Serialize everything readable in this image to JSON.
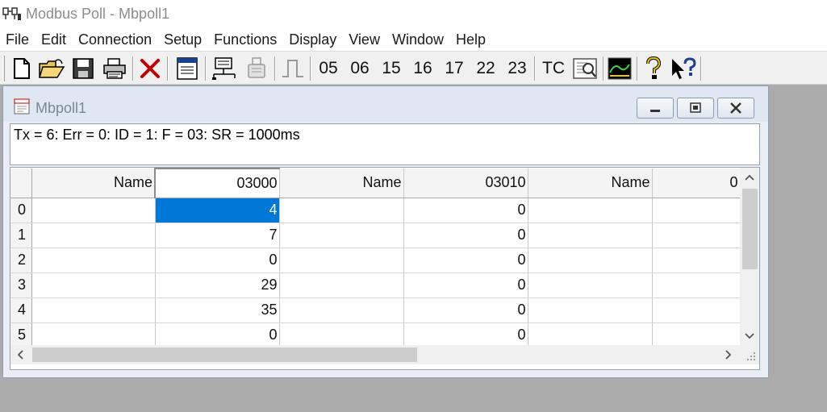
{
  "app": {
    "title": "Modbus Poll - Mbpoll1"
  },
  "menu": [
    "File",
    "Edit",
    "Connection",
    "Setup",
    "Functions",
    "Display",
    "View",
    "Window",
    "Help"
  ],
  "toolbar": {
    "function_codes": [
      "05",
      "06",
      "15",
      "16",
      "17",
      "22",
      "23"
    ],
    "tc_label": "TC"
  },
  "child": {
    "title": "Mbpoll1",
    "status": "Tx = 6: Err = 0: ID = 1: F = 03: SR = 1000ms"
  },
  "grid": {
    "headers": [
      "Name",
      "03000",
      "Name",
      "03010",
      "Name",
      "0"
    ],
    "rows": [
      {
        "index": "0",
        "c1": "",
        "c2": "4",
        "c3": "",
        "c4": "0",
        "c5": "",
        "c6": ""
      },
      {
        "index": "1",
        "c1": "",
        "c2": "7",
        "c3": "",
        "c4": "0",
        "c5": "",
        "c6": ""
      },
      {
        "index": "2",
        "c1": "",
        "c2": "0",
        "c3": "",
        "c4": "0",
        "c5": "",
        "c6": ""
      },
      {
        "index": "3",
        "c1": "",
        "c2": "29",
        "c3": "",
        "c4": "0",
        "c5": "",
        "c6": ""
      },
      {
        "index": "4",
        "c1": "",
        "c2": "35",
        "c3": "",
        "c4": "0",
        "c5": "",
        "c6": ""
      },
      {
        "index": "5",
        "c1": "",
        "c2": "0",
        "c3": "",
        "c4": "0",
        "c5": "",
        "c6": ""
      }
    ]
  },
  "colors": {
    "selection": "#0078d7",
    "desktop": "#ababab",
    "child_frame": "#dfe7f2"
  }
}
